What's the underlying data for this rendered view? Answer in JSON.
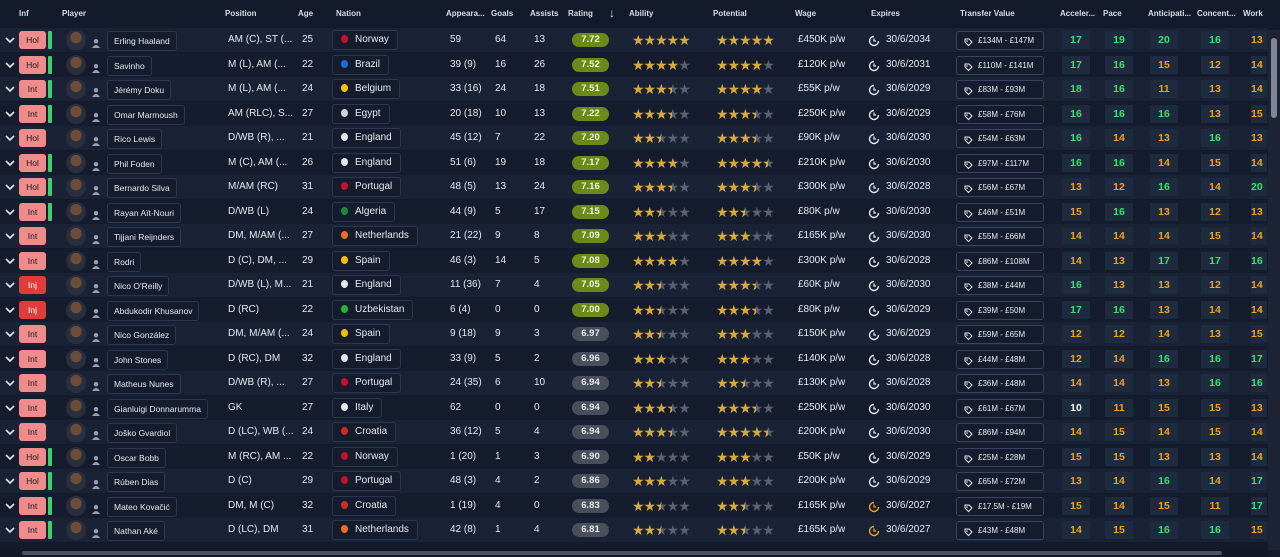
{
  "columns": {
    "inf": "Inf",
    "player": "Player",
    "position": "Position",
    "age": "Age",
    "nation": "Nation",
    "appearances": "Appeara...",
    "goals": "Goals",
    "assists": "Assists",
    "rating": "Rating",
    "ability": "Ability",
    "potential": "Potential",
    "wage": "Wage",
    "expires": "Expires",
    "transfer_value": "Transfer Value",
    "acceleration": "Acceler...",
    "pace": "Pace",
    "anticipation": "Anticipati...",
    "concentration": "Concent...",
    "work": "Work"
  },
  "sort_icon": "sort-down-arrow-icon",
  "colors": {
    "green": "#3de06a",
    "orange": "#f0a020",
    "rating_high": "#6c8a1a",
    "rating_low": "#4a4f5c",
    "star": "#d9a93a"
  },
  "rows": [
    {
      "inf": "Hol",
      "status": "hol",
      "green": true,
      "name": "Erling Haaland",
      "position": "AM (C), ST (...",
      "age": "25",
      "nation": "Norway",
      "flag": "#c8102e",
      "apps": "59",
      "goals": "64",
      "assists": "13",
      "rating": "7.72",
      "rhigh": true,
      "ability": 5,
      "potential": 5,
      "wage": "£450K p/w",
      "expires": "30/6/2034",
      "clock": "white",
      "tv": "£134M - £147M",
      "acc": [
        "17",
        "g"
      ],
      "pace": [
        "19",
        "g"
      ],
      "ant": [
        "20",
        "g"
      ],
      "con": [
        "16",
        "g"
      ],
      "work": [
        "13",
        "o"
      ]
    },
    {
      "inf": "Hol",
      "status": "hol",
      "green": true,
      "name": "Savinho",
      "position": "M (L), AM (...",
      "age": "22",
      "nation": "Brazil",
      "flag": "#1d6fd6",
      "apps": "39 (9)",
      "goals": "16",
      "assists": "26",
      "rating": "7.52",
      "rhigh": true,
      "ability": 4,
      "potential": 4,
      "wage": "£120K p/w",
      "expires": "30/6/2031",
      "clock": "white",
      "tv": "£110M - £141M",
      "acc": [
        "17",
        "g"
      ],
      "pace": [
        "16",
        "g"
      ],
      "ant": [
        "15",
        "o"
      ],
      "con": [
        "12",
        "o"
      ],
      "work": [
        "14",
        "o"
      ]
    },
    {
      "inf": "Int",
      "status": "int",
      "green": true,
      "name": "Jérémy Doku",
      "position": "M (L), AM (...",
      "age": "24",
      "nation": "Belgium",
      "flag": "#f4c300",
      "apps": "33 (16)",
      "goals": "24",
      "assists": "18",
      "rating": "7.51",
      "rhigh": true,
      "ability": 3.5,
      "potential": 4,
      "wage": "£55K p/w",
      "expires": "30/6/2029",
      "clock": "white",
      "tv": "£83M - £93M",
      "acc": [
        "18",
        "g"
      ],
      "pace": [
        "16",
        "g"
      ],
      "ant": [
        "11",
        "o"
      ],
      "con": [
        "13",
        "o"
      ],
      "work": [
        "14",
        "o"
      ]
    },
    {
      "inf": "Int",
      "status": "int",
      "green": true,
      "name": "Omar Marmoush",
      "position": "AM (RLC), S...",
      "age": "27",
      "nation": "Egypt",
      "flag": "#d4d4d4",
      "apps": "20 (18)",
      "goals": "10",
      "assists": "13",
      "rating": "7.22",
      "rhigh": true,
      "ability": 3.5,
      "potential": 3.5,
      "wage": "£250K p/w",
      "expires": "30/6/2029",
      "clock": "white",
      "tv": "£58M - £76M",
      "acc": [
        "16",
        "g"
      ],
      "pace": [
        "16",
        "g"
      ],
      "ant": [
        "16",
        "g"
      ],
      "con": [
        "13",
        "o"
      ],
      "work": [
        "15",
        "o"
      ]
    },
    {
      "inf": "Hol",
      "status": "hol",
      "green": false,
      "name": "Rico Lewis",
      "position": "D/WB (R), ...",
      "age": "21",
      "nation": "England",
      "flag": "#e8e8f0",
      "apps": "45 (12)",
      "goals": "7",
      "assists": "22",
      "rating": "7.20",
      "rhigh": true,
      "ability": 2.5,
      "potential": 3.5,
      "wage": "£90K p/w",
      "expires": "30/6/2030",
      "clock": "white",
      "tv": "£54M - £63M",
      "acc": [
        "16",
        "g"
      ],
      "pace": [
        "14",
        "o"
      ],
      "ant": [
        "13",
        "o"
      ],
      "con": [
        "16",
        "g"
      ],
      "work": [
        "13",
        "o"
      ]
    },
    {
      "inf": "Hol",
      "status": "hol",
      "green": true,
      "name": "Phil Foden",
      "position": "M (C), AM (...",
      "age": "26",
      "nation": "England",
      "flag": "#e8e8f0",
      "apps": "51 (6)",
      "goals": "19",
      "assists": "18",
      "rating": "7.17",
      "rhigh": true,
      "ability": 4,
      "potential": 4.5,
      "wage": "£210K p/w",
      "expires": "30/6/2030",
      "clock": "white",
      "tv": "£97M - £117M",
      "acc": [
        "16",
        "g"
      ],
      "pace": [
        "16",
        "g"
      ],
      "ant": [
        "14",
        "o"
      ],
      "con": [
        "15",
        "o"
      ],
      "work": [
        "14",
        "o"
      ]
    },
    {
      "inf": "Hol",
      "status": "hol",
      "green": true,
      "name": "Bernardo Silva",
      "position": "M/AM (RC)",
      "age": "31",
      "nation": "Portugal",
      "flag": "#c8102e",
      "apps": "48 (5)",
      "goals": "13",
      "assists": "24",
      "rating": "7.16",
      "rhigh": true,
      "ability": 3.5,
      "potential": 3.5,
      "wage": "£300K p/w",
      "expires": "30/6/2028",
      "clock": "white",
      "tv": "£56M - £67M",
      "acc": [
        "13",
        "o"
      ],
      "pace": [
        "12",
        "o"
      ],
      "ant": [
        "16",
        "g"
      ],
      "con": [
        "14",
        "o"
      ],
      "work": [
        "20",
        "g"
      ]
    },
    {
      "inf": "Int",
      "status": "int",
      "green": true,
      "name": "Rayan Aït-Nouri",
      "position": "D/WB (L)",
      "age": "24",
      "nation": "Algeria",
      "flag": "#1c8a3c",
      "apps": "44 (9)",
      "goals": "5",
      "assists": "17",
      "rating": "7.15",
      "rhigh": true,
      "ability": 2.5,
      "potential": 2.5,
      "wage": "£80K p/w",
      "expires": "30/6/2030",
      "clock": "white",
      "tv": "£46M - £51M",
      "acc": [
        "15",
        "o"
      ],
      "pace": [
        "16",
        "g"
      ],
      "ant": [
        "13",
        "o"
      ],
      "con": [
        "12",
        "o"
      ],
      "work": [
        "13",
        "o"
      ]
    },
    {
      "inf": "Int",
      "status": "int",
      "green": false,
      "name": "Tijjani Reijnders",
      "position": "DM, M/AM (...",
      "age": "27",
      "nation": "Netherlands",
      "flag": "#f36c21",
      "apps": "21 (22)",
      "goals": "9",
      "assists": "8",
      "rating": "7.09",
      "rhigh": true,
      "ability": 3,
      "potential": 3,
      "wage": "£165K p/w",
      "expires": "30/6/2030",
      "clock": "white",
      "tv": "£55M - £66M",
      "acc": [
        "14",
        "o"
      ],
      "pace": [
        "14",
        "o"
      ],
      "ant": [
        "14",
        "o"
      ],
      "con": [
        "15",
        "o"
      ],
      "work": [
        "14",
        "o"
      ]
    },
    {
      "inf": "Int",
      "status": "int",
      "green": false,
      "name": "Rodri",
      "position": "D (C), DM, ...",
      "age": "29",
      "nation": "Spain",
      "flag": "#f1bf00",
      "apps": "46 (3)",
      "goals": "14",
      "assists": "5",
      "rating": "7.08",
      "rhigh": true,
      "ability": 4,
      "potential": 4,
      "wage": "£300K p/w",
      "expires": "30/6/2028",
      "clock": "white",
      "tv": "£86M - £108M",
      "acc": [
        "14",
        "o"
      ],
      "pace": [
        "13",
        "o"
      ],
      "ant": [
        "17",
        "g"
      ],
      "con": [
        "17",
        "g"
      ],
      "work": [
        "16",
        "g"
      ]
    },
    {
      "inf": "Inj",
      "status": "inj",
      "green": false,
      "name": "Nico O'Reilly",
      "position": "D/WB (L), M...",
      "age": "21",
      "nation": "England",
      "flag": "#e8e8f0",
      "apps": "11 (36)",
      "goals": "7",
      "assists": "4",
      "rating": "7.05",
      "rhigh": true,
      "ability": 2.5,
      "potential": 3.5,
      "wage": "£60K p/w",
      "expires": "30/6/2030",
      "clock": "white",
      "tv": "£38M - £44M",
      "acc": [
        "16",
        "g"
      ],
      "pace": [
        "13",
        "o"
      ],
      "ant": [
        "13",
        "o"
      ],
      "con": [
        "12",
        "o"
      ],
      "work": [
        "14",
        "o"
      ]
    },
    {
      "inf": "Inj",
      "status": "inj",
      "green": false,
      "name": "Abdukodir Khusanov",
      "position": "D (RC)",
      "age": "22",
      "nation": "Uzbekistan",
      "flag": "#1eb53a",
      "apps": "6 (4)",
      "goals": "0",
      "assists": "0",
      "rating": "7.00",
      "rhigh": true,
      "ability": 2.5,
      "potential": 3.5,
      "wage": "£80K p/w",
      "expires": "30/6/2029",
      "clock": "white",
      "tv": "£39M - £50M",
      "acc": [
        "17",
        "g"
      ],
      "pace": [
        "16",
        "g"
      ],
      "ant": [
        "13",
        "o"
      ],
      "con": [
        "14",
        "o"
      ],
      "work": [
        "14",
        "o"
      ]
    },
    {
      "inf": "Int",
      "status": "int",
      "green": false,
      "name": "Nico González",
      "position": "DM, M/AM (...",
      "age": "24",
      "nation": "Spain",
      "flag": "#f1bf00",
      "apps": "9 (18)",
      "goals": "9",
      "assists": "3",
      "rating": "6.97",
      "rhigh": false,
      "ability": 2.5,
      "potential": 3,
      "wage": "£150K p/w",
      "expires": "30/6/2029",
      "clock": "white",
      "tv": "£59M - £65M",
      "acc": [
        "12",
        "o"
      ],
      "pace": [
        "12",
        "o"
      ],
      "ant": [
        "14",
        "o"
      ],
      "con": [
        "13",
        "o"
      ],
      "work": [
        "15",
        "o"
      ]
    },
    {
      "inf": "Int",
      "status": "int",
      "green": false,
      "name": "John Stones",
      "position": "D (RC), DM",
      "age": "32",
      "nation": "England",
      "flag": "#e8e8f0",
      "apps": "33 (9)",
      "goals": "5",
      "assists": "2",
      "rating": "6.96",
      "rhigh": false,
      "ability": 3,
      "potential": 3,
      "wage": "£140K p/w",
      "expires": "30/6/2028",
      "clock": "white",
      "tv": "£44M - £48M",
      "acc": [
        "12",
        "o"
      ],
      "pace": [
        "14",
        "o"
      ],
      "ant": [
        "16",
        "g"
      ],
      "con": [
        "16",
        "g"
      ],
      "work": [
        "17",
        "g"
      ]
    },
    {
      "inf": "Int",
      "status": "int",
      "green": false,
      "name": "Matheus Nunes",
      "position": "D/WB (R), ...",
      "age": "27",
      "nation": "Portugal",
      "flag": "#c8102e",
      "apps": "24 (35)",
      "goals": "6",
      "assists": "10",
      "rating": "6.94",
      "rhigh": false,
      "ability": 2.5,
      "potential": 2.5,
      "wage": "£130K p/w",
      "expires": "30/6/2028",
      "clock": "white",
      "tv": "£36M - £48M",
      "acc": [
        "14",
        "o"
      ],
      "pace": [
        "14",
        "o"
      ],
      "ant": [
        "13",
        "o"
      ],
      "con": [
        "16",
        "g"
      ],
      "work": [
        "16",
        "g"
      ]
    },
    {
      "inf": "Int",
      "status": "int",
      "green": false,
      "name": "Gianluigi Donnarumma",
      "position": "GK",
      "age": "27",
      "nation": "Italy",
      "flag": "#e8e8e8",
      "apps": "62",
      "goals": "0",
      "assists": "0",
      "rating": "6.94",
      "rhigh": false,
      "ability": 3.5,
      "potential": 3.5,
      "wage": "£250K p/w",
      "expires": "30/6/2030",
      "clock": "white",
      "tv": "£61M - £67M",
      "acc": [
        "10",
        "w"
      ],
      "pace": [
        "11",
        "o"
      ],
      "ant": [
        "15",
        "o"
      ],
      "con": [
        "15",
        "o"
      ],
      "work": [
        "13",
        "o"
      ]
    },
    {
      "inf": "Int",
      "status": "int",
      "green": false,
      "name": "Joško Gvardiol",
      "position": "D (LC), WB (...",
      "age": "24",
      "nation": "Croatia",
      "flag": "#d52b1e",
      "apps": "36 (12)",
      "goals": "5",
      "assists": "4",
      "rating": "6.94",
      "rhigh": false,
      "ability": 3.5,
      "potential": 4.5,
      "wage": "£200K p/w",
      "expires": "30/6/2030",
      "clock": "white",
      "tv": "£86M - £94M",
      "acc": [
        "14",
        "o"
      ],
      "pace": [
        "15",
        "o"
      ],
      "ant": [
        "14",
        "o"
      ],
      "con": [
        "15",
        "o"
      ],
      "work": [
        "14",
        "o"
      ]
    },
    {
      "inf": "Hol",
      "status": "hol",
      "green": true,
      "name": "Oscar Bobb",
      "position": "M (RC), AM ...",
      "age": "22",
      "nation": "Norway",
      "flag": "#c8102e",
      "apps": "1 (20)",
      "goals": "1",
      "assists": "3",
      "rating": "6.90",
      "rhigh": false,
      "ability": 2,
      "potential": 3,
      "wage": "£50K p/w",
      "expires": "30/6/2029",
      "clock": "white",
      "tv": "£25M - £28M",
      "acc": [
        "15",
        "o"
      ],
      "pace": [
        "15",
        "o"
      ],
      "ant": [
        "13",
        "o"
      ],
      "con": [
        "13",
        "o"
      ],
      "work": [
        "14",
        "o"
      ]
    },
    {
      "inf": "Hol",
      "status": "hol",
      "green": true,
      "name": "Rúben Dias",
      "position": "D (C)",
      "age": "29",
      "nation": "Portugal",
      "flag": "#c8102e",
      "apps": "48 (3)",
      "goals": "4",
      "assists": "2",
      "rating": "6.86",
      "rhigh": false,
      "ability": 3,
      "potential": 3,
      "wage": "£200K p/w",
      "expires": "30/6/2029",
      "clock": "white",
      "tv": "£65M - £72M",
      "acc": [
        "13",
        "o"
      ],
      "pace": [
        "14",
        "o"
      ],
      "ant": [
        "16",
        "g"
      ],
      "con": [
        "14",
        "o"
      ],
      "work": [
        "17",
        "g"
      ]
    },
    {
      "inf": "Int",
      "status": "int",
      "green": true,
      "name": "Mateo Kovačić",
      "position": "DM, M (C)",
      "age": "32",
      "nation": "Croatia",
      "flag": "#d52b1e",
      "apps": "1 (19)",
      "goals": "4",
      "assists": "0",
      "rating": "6.83",
      "rhigh": false,
      "ability": 2.5,
      "potential": 2.5,
      "wage": "£165K p/w",
      "expires": "30/6/2027",
      "clock": "orange",
      "tv": "£17.5M - £19M",
      "acc": [
        "15",
        "o"
      ],
      "pace": [
        "14",
        "o"
      ],
      "ant": [
        "15",
        "o"
      ],
      "con": [
        "11",
        "o"
      ],
      "work": [
        "17",
        "g"
      ]
    },
    {
      "inf": "Int",
      "status": "int",
      "green": true,
      "name": "Nathan Aké",
      "position": "D (LC), DM",
      "age": "31",
      "nation": "Netherlands",
      "flag": "#f36c21",
      "apps": "42 (8)",
      "goals": "1",
      "assists": "4",
      "rating": "6.81",
      "rhigh": false,
      "ability": 2.5,
      "potential": 2.5,
      "wage": "£165K p/w",
      "expires": "30/6/2027",
      "clock": "orange",
      "tv": "£43M - £48M",
      "acc": [
        "14",
        "o"
      ],
      "pace": [
        "15",
        "o"
      ],
      "ant": [
        "16",
        "g"
      ],
      "con": [
        "16",
        "g"
      ],
      "work": [
        "15",
        "o"
      ]
    }
  ]
}
